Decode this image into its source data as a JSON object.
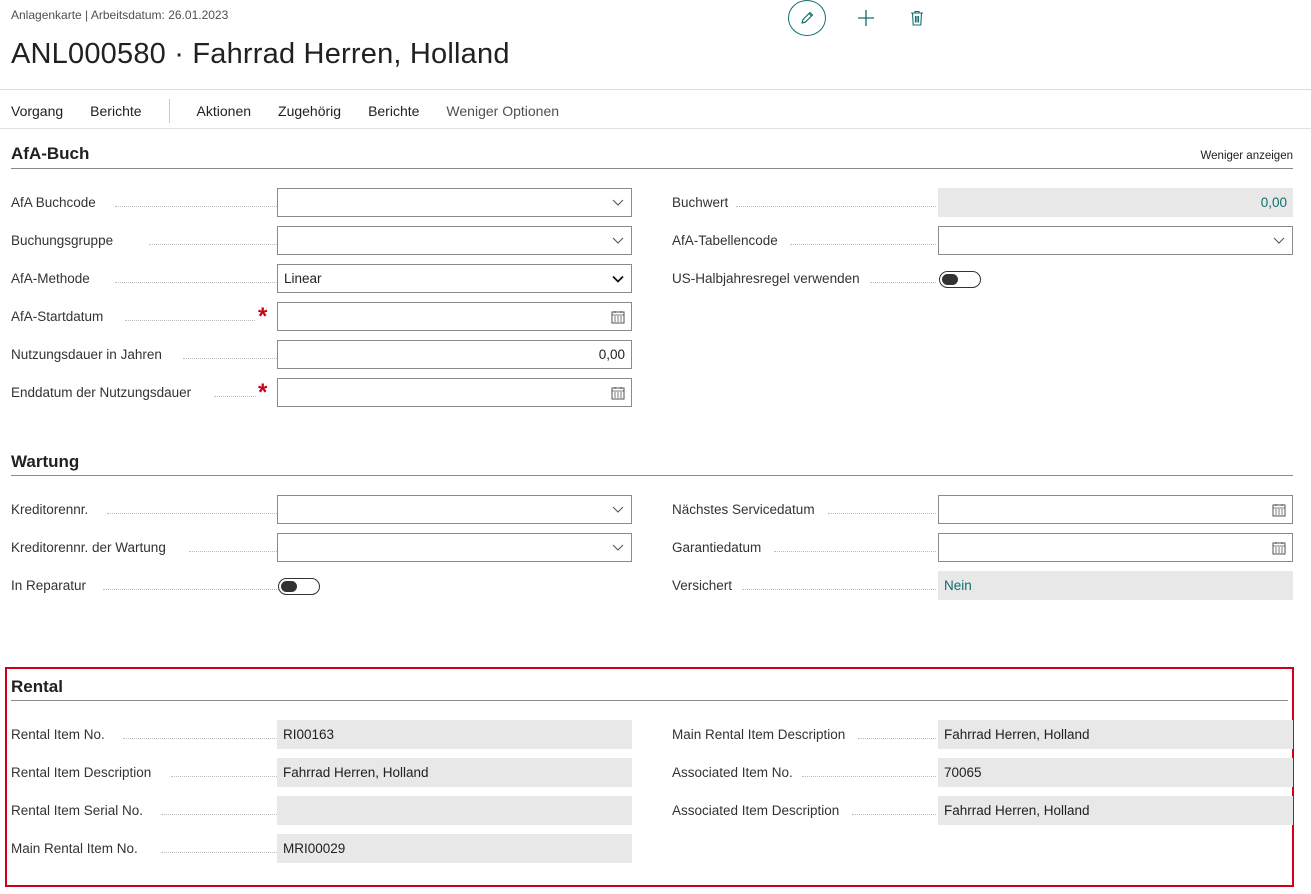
{
  "breadcrumb": "Anlagenkarte | Arbeitsdatum: 26.01.2023",
  "title": "ANL000580 · Fahrrad Herren, Holland",
  "actions": {
    "left": [
      "Vorgang",
      "Berichte"
    ],
    "right": [
      "Aktionen",
      "Zugehörig",
      "Berichte"
    ],
    "fewer_options": "Weniger Optionen"
  },
  "icons": {
    "edit": "pencil-icon",
    "add": "plus-icon",
    "delete": "trash-icon",
    "dropdown": "chevron-down-icon",
    "calendar": "calendar-icon"
  },
  "colors": {
    "accent": "#0f6f6c",
    "required": "#d0001c",
    "readonly_bg": "#e8e8e8"
  },
  "afa": {
    "title": "AfA-Buch",
    "show_less": "Weniger anzeigen",
    "buchcode": {
      "label": "AfA Buchcode",
      "value": ""
    },
    "buchungsgruppe": {
      "label": "Buchungsgruppe",
      "value": ""
    },
    "methode": {
      "label": "AfA-Methode",
      "value": "Linear"
    },
    "startdatum": {
      "label": "AfA-Startdatum",
      "value": ""
    },
    "nutzungsdauer": {
      "label": "Nutzungsdauer in Jahren",
      "value": "0,00"
    },
    "enddatum": {
      "label": "Enddatum der Nutzungsdauer",
      "value": ""
    },
    "buchwert": {
      "label": "Buchwert",
      "value": "0,00"
    },
    "tabellencode": {
      "label": "AfA-Tabellencode",
      "value": ""
    },
    "halbjahresregel": {
      "label": "US-Halbjahresregel verwenden",
      "value": "off"
    }
  },
  "wartung": {
    "title": "Wartung",
    "kreditorennr": {
      "label": "Kreditorennr.",
      "value": ""
    },
    "kreditorennr_wartung": {
      "label": "Kreditorennr. der Wartung",
      "value": ""
    },
    "in_reparatur": {
      "label": "In Reparatur",
      "value": "off"
    },
    "servicedatum": {
      "label": "Nächstes Servicedatum",
      "value": ""
    },
    "garantiedatum": {
      "label": "Garantiedatum",
      "value": ""
    },
    "versichert": {
      "label": "Versichert",
      "value": "Nein"
    }
  },
  "rental": {
    "title": "Rental",
    "item_no": {
      "label": "Rental Item No.",
      "value": "RI00163"
    },
    "item_desc": {
      "label": "Rental Item Description",
      "value": "Fahrrad Herren, Holland"
    },
    "serial_no": {
      "label": "Rental Item Serial No.",
      "value": ""
    },
    "main_no": {
      "label": "Main Rental Item No.",
      "value": "MRI00029"
    },
    "main_desc": {
      "label": "Main Rental Item Description",
      "value": "Fahrrad Herren, Holland"
    },
    "assoc_no": {
      "label": "Associated Item No.",
      "value": "70065"
    },
    "assoc_desc": {
      "label": "Associated Item Description",
      "value": "Fahrrad Herren, Holland"
    }
  }
}
